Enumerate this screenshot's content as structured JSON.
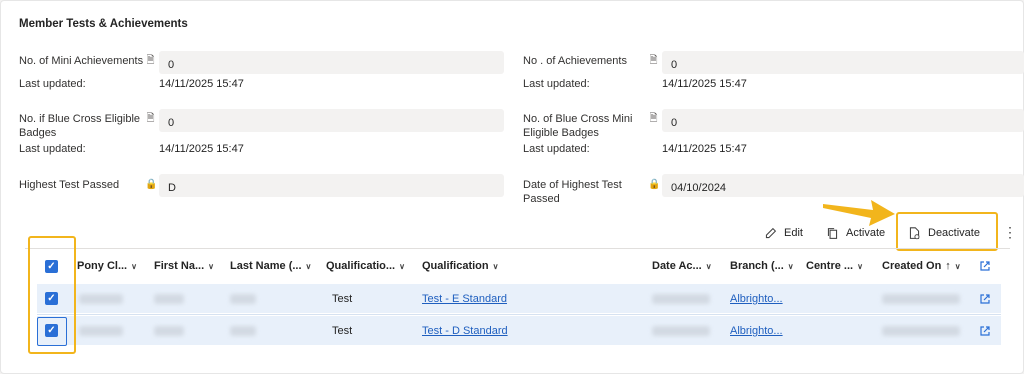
{
  "section": {
    "title": "Member Tests & Achievements"
  },
  "fields": {
    "mini_achievements": {
      "label": "No. of Mini Achievements",
      "value": "0",
      "updated_label": "Last updated:",
      "updated_value": "14/11/2025 15:47"
    },
    "achievements": {
      "label": "No . of Achievements",
      "value": "0",
      "updated_label": "Last updated:",
      "updated_value": "14/11/2025 15:47"
    },
    "blue_cross": {
      "label_line1": "No. if Blue Cross Eligible",
      "label_line2": "Badges",
      "value": "0",
      "updated_label": "Last updated:",
      "updated_value": "14/11/2025 15:47"
    },
    "blue_cross_mini": {
      "label_line1": "No. of Blue Cross Mini",
      "label_line2": "Eligible Badges",
      "value": "0",
      "updated_label": "Last updated:",
      "updated_value": "14/11/2025 15:47"
    },
    "highest_test": {
      "label": "Highest Test Passed",
      "value": "D"
    },
    "date_highest_test": {
      "label_line1": "Date of Highest Test",
      "label_line2": "Passed",
      "value": "04/10/2024"
    }
  },
  "toolbar": {
    "edit_label": "Edit",
    "activate_label": "Activate",
    "deactivate_label": "Deactivate",
    "more_label": "⋮"
  },
  "grid": {
    "columns": [
      "Pony Cl...",
      "First Na...",
      "Last Name (...",
      "Qualificatio...",
      "Qualification",
      "Date Ac...",
      "Branch (...",
      "Centre ...",
      "Created On"
    ],
    "sort_indicator": "↑",
    "rows": [
      {
        "qualification_type": "Test",
        "qualification": "Test - E Standard",
        "branch": "Albrighto...",
        "selected": true
      },
      {
        "qualification_type": "Test",
        "qualification": "Test - D Standard",
        "branch": "Albrighto...",
        "selected": true
      }
    ]
  },
  "colors": {
    "accent": "#2a6fd6",
    "highlight": "#f2b51c",
    "link": "#1f5fbf",
    "row_selected": "#e8f0fa"
  },
  "icons": [
    "lock-icon",
    "pencil-icon",
    "copy-icon",
    "deactivate-doc-icon",
    "more-icon",
    "chevron-down-icon",
    "open-external-icon",
    "checkbox-checked-icon",
    "arrow-pointer-icon"
  ]
}
